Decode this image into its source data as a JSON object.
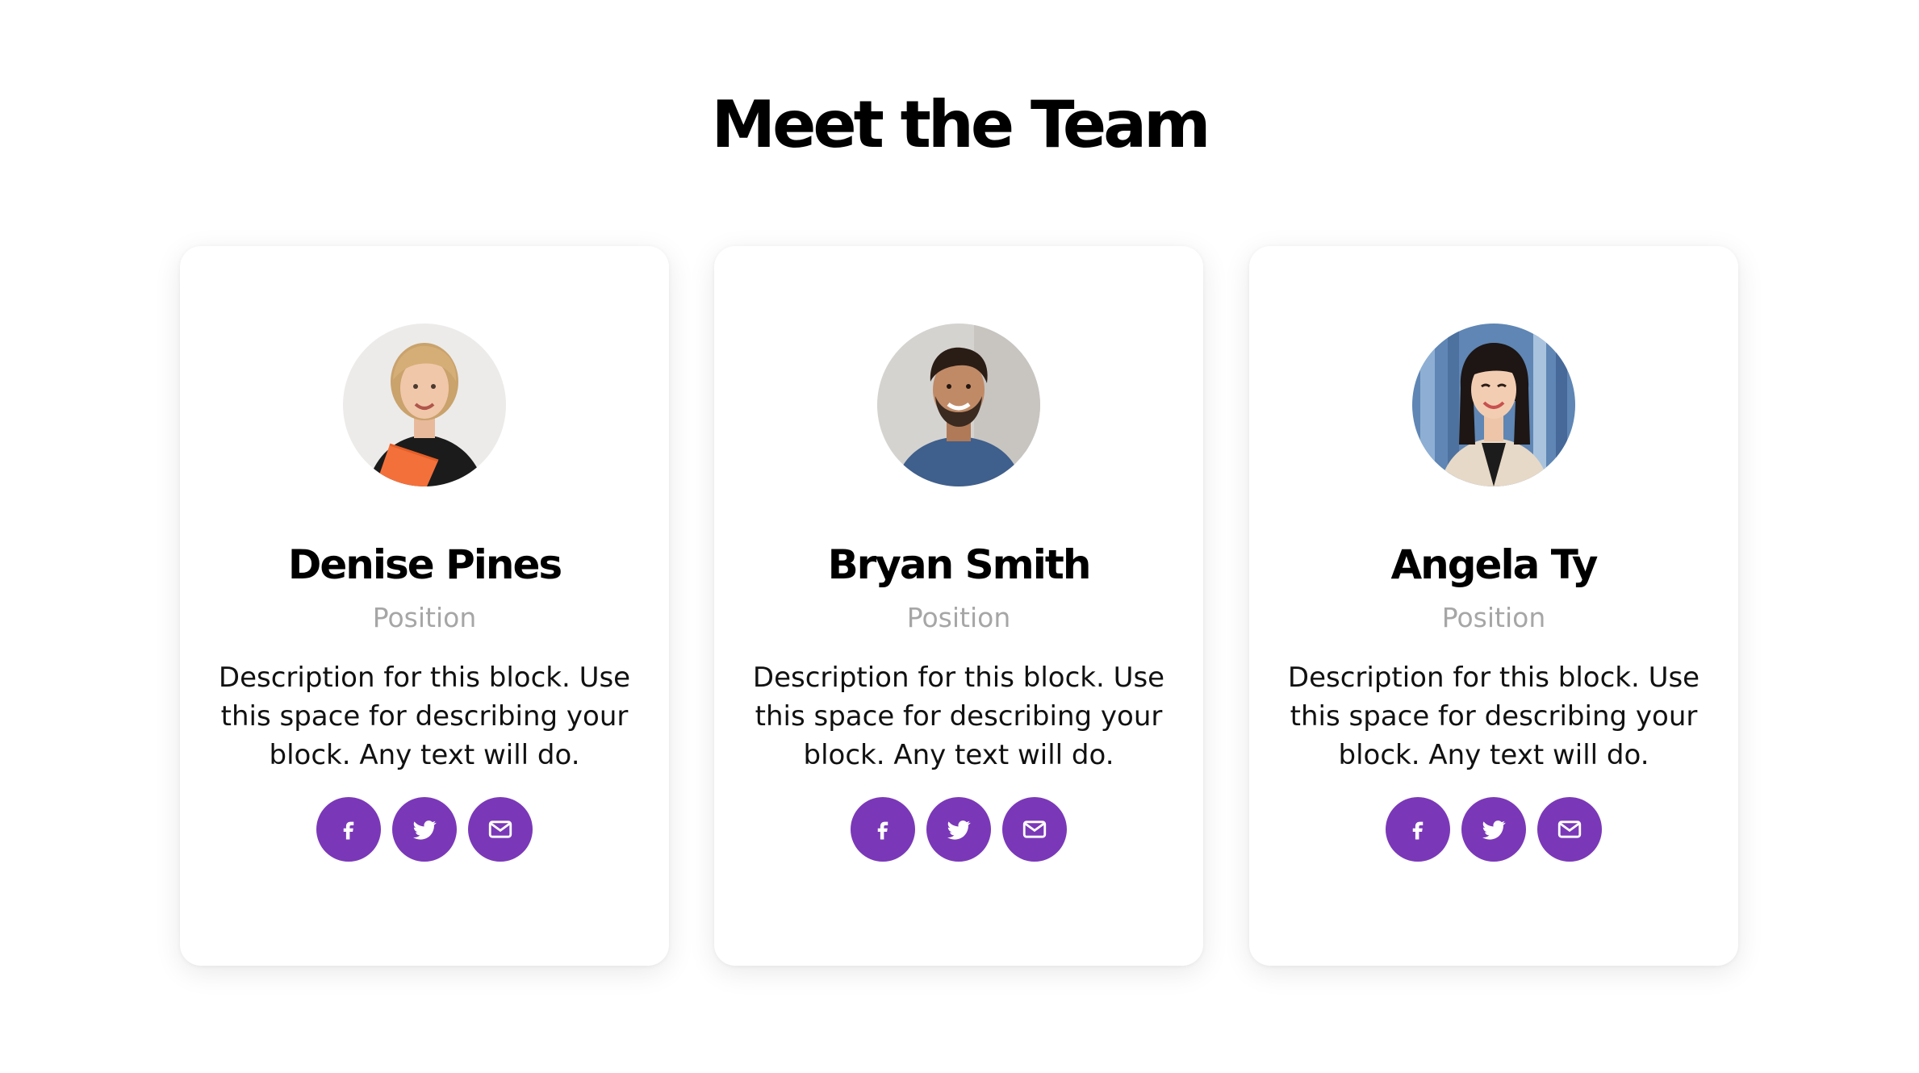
{
  "section": {
    "title": "Meet the Team"
  },
  "theme": {
    "accent": "#7a38b8",
    "position_text": "#a6a6a6"
  },
  "members": [
    {
      "name": "Denise Pines",
      "position": "Position",
      "description": "Description for this block. Use this space for describing your block. Any text will do.",
      "avatar_icon": "woman-blonde-portrait",
      "socials": [
        "facebook-icon",
        "twitter-icon",
        "email-icon"
      ]
    },
    {
      "name": "Bryan Smith",
      "position": "Position",
      "description": "Description for this block. Use this space for describing your block. Any text will do.",
      "avatar_icon": "man-beard-portrait",
      "socials": [
        "facebook-icon",
        "twitter-icon",
        "email-icon"
      ]
    },
    {
      "name": "Angela Ty",
      "position": "Position",
      "description": "Description for this block. Use this space for describing your block. Any text will do.",
      "avatar_icon": "woman-dark-hair-portrait",
      "socials": [
        "facebook-icon",
        "twitter-icon",
        "email-icon"
      ]
    }
  ]
}
